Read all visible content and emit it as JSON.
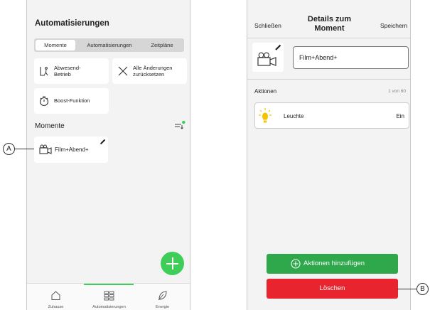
{
  "left_screen": {
    "title": "Automatisierungen",
    "tabs": [
      {
        "label": "Momente",
        "active": true
      },
      {
        "label": "Automatisierungen",
        "active": false
      },
      {
        "label": "Zeitpläne",
        "active": false
      }
    ],
    "quick_cards": [
      {
        "label_line1": "Abwesend-",
        "label_line2": "Betrieb",
        "icon": "away-mode-icon"
      },
      {
        "label_line1": "Alle Änderungen",
        "label_line2": "zurücksetzen",
        "icon": "close-x-icon"
      },
      {
        "label_line1": "Boost-Funktion",
        "label_line2": "",
        "icon": "timer-icon"
      }
    ],
    "moments_section": {
      "label": "Momente",
      "sort_icon": "sort-icon"
    },
    "moment_card": {
      "label": "Film+Abend+",
      "icon": "camera-icon",
      "edit_icon": "pencil-icon"
    },
    "fab_icon": "plus-icon",
    "bottom_nav": [
      {
        "label": "Zuhause",
        "icon": "home-icon",
        "active": false
      },
      {
        "label": "Automatisierungen",
        "icon": "automation-grid-icon",
        "active": true
      },
      {
        "label": "Energie",
        "icon": "leaf-icon",
        "active": false
      }
    ]
  },
  "right_screen": {
    "close_label": "Schließen",
    "title_line1": "Details zum",
    "title_line2": "Moment",
    "save_label": "Speichern",
    "moment_name": "Film+Abend+",
    "moment_icon": "camera-icon",
    "actions_label": "Aktionen",
    "actions_count": "1 von 60",
    "action_row": {
      "label": "Leuchte",
      "value": "Ein",
      "icon": "light-bulb-icon"
    },
    "add_actions_label": "Aktionen hinzufügen",
    "delete_label": "Löschen"
  },
  "callouts": {
    "a": "A",
    "b": "B"
  },
  "colors": {
    "accent_green": "#3dcd58",
    "button_green": "#2ea84a",
    "delete_red": "#e8242f",
    "bulb_yellow": "#f5c400"
  }
}
